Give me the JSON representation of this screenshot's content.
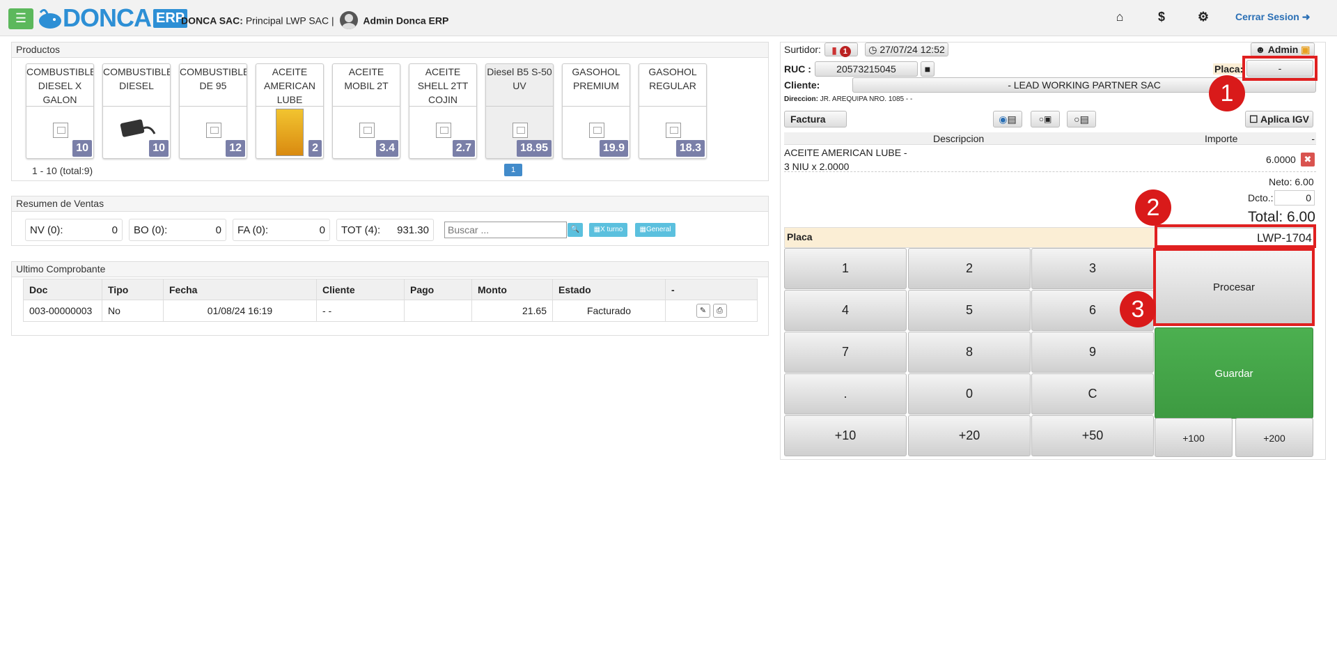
{
  "header": {
    "logo_text": "DONCA",
    "logo_erp": "ERP",
    "company_bold": "DONCA SAC:",
    "company_rest": "Principal LWP SAC |",
    "user_name": "Admin Donca ERP",
    "logout_label": "Cerrar Sesion"
  },
  "productos": {
    "title": "Productos",
    "items": [
      {
        "name": "COMBUSTIBLE DIESEL X GALON",
        "price": "10"
      },
      {
        "name": "COMBUSTIBLE DIESEL",
        "price": "10"
      },
      {
        "name": "COMBUSTIBLE DE 95",
        "price": "12"
      },
      {
        "name": "ACEITE AMERICAN LUBE",
        "price": "2"
      },
      {
        "name": "ACEITE MOBIL 2T",
        "price": "3.4"
      },
      {
        "name": "ACEITE SHELL 2TT COJIN",
        "price": "2.7"
      },
      {
        "name": "Diesel B5 S-50 UV",
        "price": "18.95"
      },
      {
        "name": "GASOHOL PREMIUM",
        "price": "19.9"
      },
      {
        "name": "GASOHOL REGULAR",
        "price": "18.3"
      }
    ],
    "range_text": "1 - 10 (total:9)",
    "page": "1"
  },
  "resumen": {
    "title": "Resumen de Ventas",
    "boxes": [
      {
        "label": "NV (0):",
        "value": "0"
      },
      {
        "label": "BO (0):",
        "value": "0"
      },
      {
        "label": "FA (0):",
        "value": "0"
      },
      {
        "label": "TOT (4):",
        "value": "931.30"
      }
    ],
    "search_placeholder": "Buscar ...",
    "xturno_label": "X turno",
    "general_label": "General"
  },
  "ultimo": {
    "title": "Ultimo Comprobante",
    "columns": [
      "Doc",
      "Tipo",
      "Fecha",
      "Cliente",
      "Pago",
      "Monto",
      "Estado",
      "-"
    ],
    "row": {
      "doc": "003-00000003",
      "tipo": "No",
      "fecha": "01/08/24 16:19",
      "cliente": "- -",
      "pago": "",
      "monto": "21.65",
      "estado": "Facturado"
    }
  },
  "venta": {
    "surtidor_label": "Surtidor:",
    "surtidor_count": "1",
    "datetime": "27/07/24 12:52",
    "admin_label": "Admin",
    "ruc_label": "RUC :",
    "ruc_value": "20573215045",
    "placa_label": "Placa:",
    "placa_value": "-",
    "cliente_label": "Cliente:",
    "cliente_value": "- LEAD WORKING PARTNER SAC",
    "direccion_label": "Direccion:",
    "direccion_value": "JR. AREQUIPA NRO. 1085 - -",
    "doc_type": "Factura",
    "aplica_igv": "Aplica IGV",
    "col_desc": "Descripcion",
    "col_importe": "Importe",
    "col_dash": "-",
    "item_line1": "ACEITE AMERICAN LUBE -",
    "item_line2": "3 NIU x 2.0000",
    "item_importe": "6.0000",
    "neto": "Neto: 6.00",
    "dcto_label": "Dcto.:",
    "dcto_value": "0",
    "total": "Total: 6.00",
    "placa_input_label": "Placa",
    "placa_input_value": "LWP-1704",
    "keys": [
      "1",
      "2",
      "3",
      "4",
      "5",
      "6",
      "7",
      "8",
      "9",
      ".",
      "0",
      "C",
      "+10",
      "+20",
      "+50"
    ],
    "procesar": "Procesar",
    "guardar": "Guardar",
    "plus100": "+100",
    "plus200": "+200"
  },
  "annotations": [
    "1",
    "2",
    "3"
  ],
  "colors": {
    "accent": "#428bca",
    "guardar": "#45a849",
    "price_badge": "#7a7fa8",
    "annotation": "#d91a1a"
  }
}
